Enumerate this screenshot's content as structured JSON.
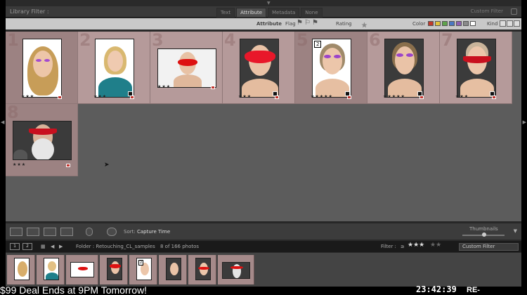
{
  "library_filter": {
    "title": "Library Filter :",
    "tabs": [
      {
        "label": "Text",
        "active": false
      },
      {
        "label": "Attribute",
        "active": true
      },
      {
        "label": "Metadata",
        "active": false
      },
      {
        "label": "None",
        "active": false
      }
    ],
    "preset": "Custom Filter"
  },
  "attribute_bar": {
    "attribute_label": "Attribute",
    "flag_label": "Flag",
    "rating_label": "Rating",
    "color_label": "Color",
    "kind_label": "Kind",
    "rating_stars": [
      "★",
      "★",
      "☆",
      "☆",
      "☆"
    ],
    "color_swatches": [
      "#c0392b",
      "#e2c23a",
      "#5ea34b",
      "#4a77c2",
      "#8e5fb3",
      "#8a8a8a",
      "#ffffff"
    ]
  },
  "grid": {
    "cells": [
      {
        "number": "1",
        "rating": "★★★"
      },
      {
        "number": "2",
        "rating": "★★★"
      },
      {
        "number": "3",
        "rating": "★★★"
      },
      {
        "number": "4",
        "rating": "★★★"
      },
      {
        "number": "5",
        "rating": "★★★★★",
        "badge": "2"
      },
      {
        "number": "6",
        "rating": "★★★★★"
      },
      {
        "number": "7",
        "rating": "★★★"
      },
      {
        "number": "8",
        "rating": "★★★"
      }
    ]
  },
  "toolbar": {
    "sort_label": "Sort:",
    "sort_value": "Capture Time",
    "thumbnails_label": "Thumbnails"
  },
  "filmstrip_header": {
    "monitor_1": "1",
    "monitor_2": "2",
    "folder": "Folder : Retouching_CL_samples",
    "count": "8 of 166 photos",
    "filter_label": "Filter :",
    "filter_op": "≥",
    "filter_stars": "★★★",
    "filter_empty_stars": "★★",
    "filter_preset": "Custom Filter"
  },
  "overlay": {
    "promo": "$99 Deal Ends at 9PM Tomorrow!",
    "clock": "23:42:39",
    "rebroadcast": "RE-BROADCAST"
  }
}
